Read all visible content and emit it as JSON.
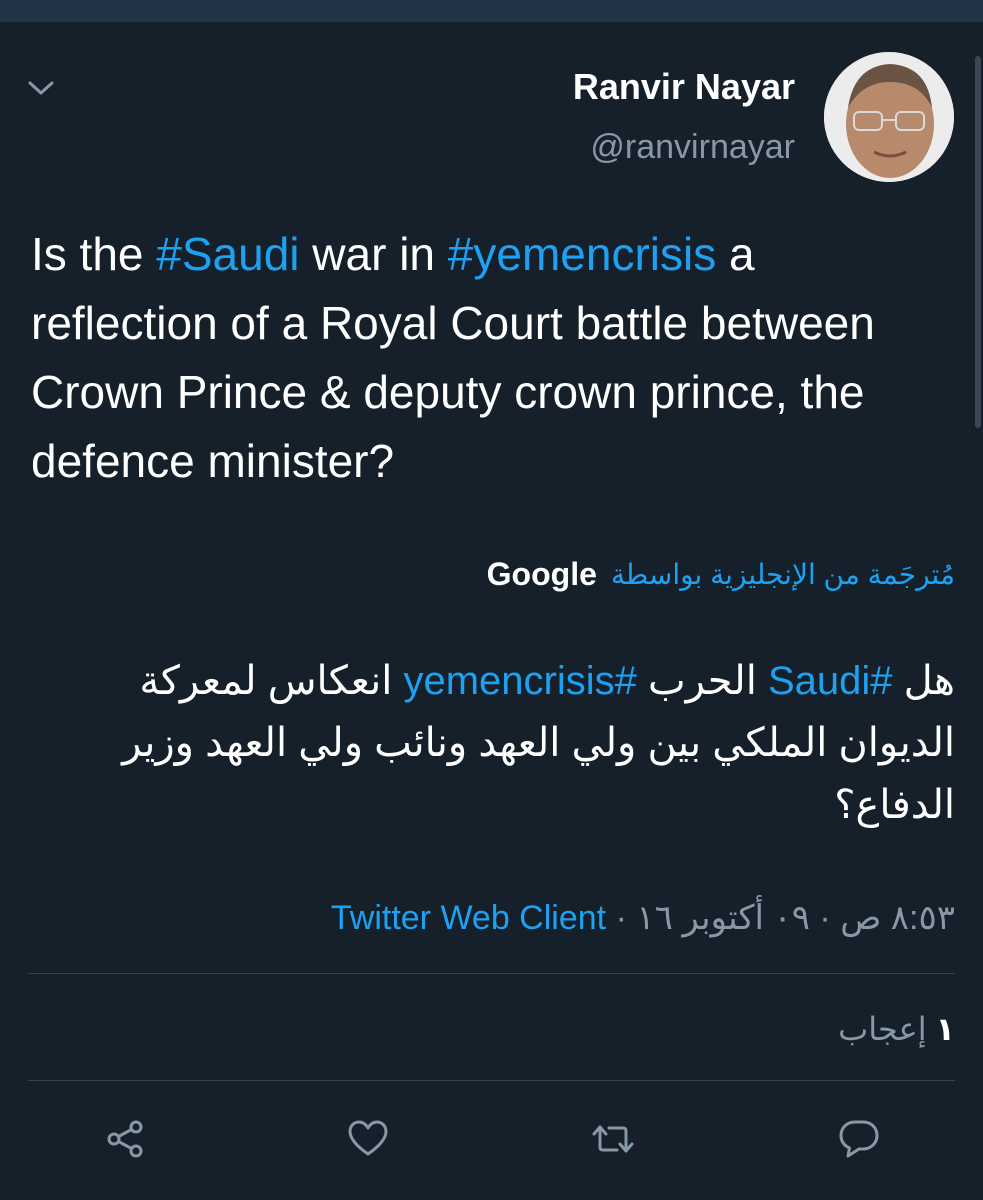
{
  "tweet": {
    "author_name": "Ranvir Nayar",
    "author_handle": "@ranvirnayar",
    "text_parts": [
      "Is the ",
      "#Saudi",
      " war in ",
      "#yemencrisis",
      " a reflection of a Royal Court battle between Crown Prince & deputy crown prince, the defence minister?"
    ],
    "translation_label": "مُترجَمة من الإنجليزية بواسطة",
    "translation_provider": "Google",
    "translated_parts": [
      "هل ",
      "#Saudi",
      " الحرب ",
      "#yemencrisis",
      " انعكاس لمعركة الديوان الملكي بين ولي العهد ونائب ولي العهد وزير الدفاع؟"
    ],
    "timestamp": "٨:٥٣ ص · ٠٩ أكتوبر ١٦ · ",
    "client": "Twitter Web Client",
    "likes_count": "١",
    "likes_label": "إعجاب"
  },
  "icons": {
    "menu": "chevron-down-icon",
    "share": "share-icon",
    "like": "heart-icon",
    "retweet": "retweet-icon",
    "reply": "reply-icon"
  },
  "colors": {
    "background": "#15202b",
    "accent": "#1da1f2",
    "secondary_text": "#8899a6",
    "divider": "#38444d"
  }
}
